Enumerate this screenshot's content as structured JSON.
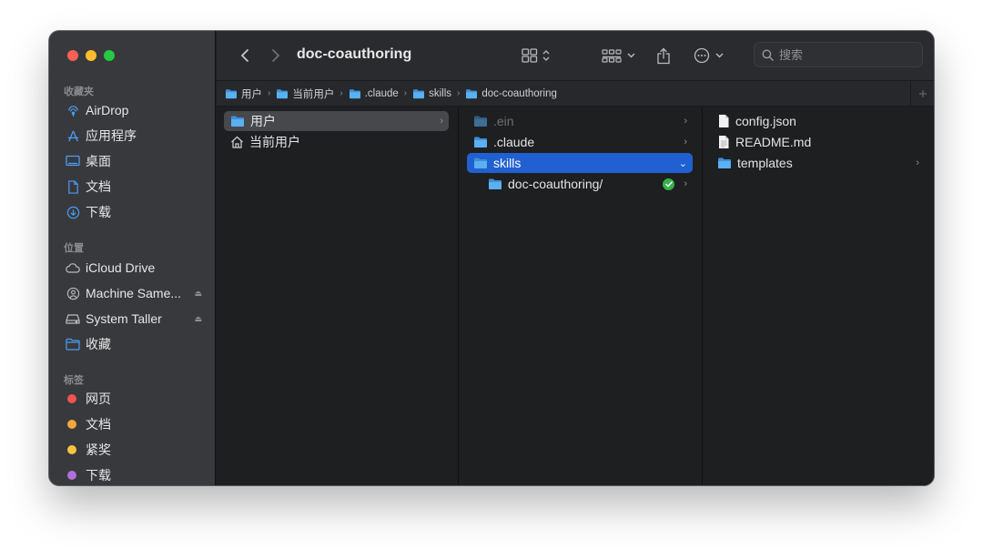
{
  "window": {
    "title": "doc-coauthoring"
  },
  "sidebar": {
    "favorites_label": "收藏夹",
    "favorites": [
      {
        "label": "AirDrop",
        "icon": "airdrop-icon"
      },
      {
        "label": "应用程序",
        "icon": "applications-icon"
      },
      {
        "label": "桌面",
        "icon": "desktop-icon"
      },
      {
        "label": "文档",
        "icon": "document-icon"
      },
      {
        "label": "下载",
        "icon": "download-icon"
      }
    ],
    "locations_label": "位置",
    "locations": [
      {
        "label": "iCloud Drive",
        "icon": "cloud-icon"
      },
      {
        "label": "Machine Same...",
        "icon": "network-drive-icon"
      },
      {
        "label": "System Taller",
        "icon": "disk-icon"
      },
      {
        "label": "收藏",
        "icon": "folder-icon"
      }
    ],
    "tags_label": "标签",
    "tags": [
      {
        "label": "网页",
        "color": "#ef5350"
      },
      {
        "label": "文档",
        "color": "#f4a53c"
      },
      {
        "label": "紧奖",
        "color": "#f6c344"
      },
      {
        "label": "下载",
        "color": "#b36fd9"
      }
    ]
  },
  "toolbar": {
    "search_placeholder": "搜索"
  },
  "pathbar": {
    "crumbs": [
      "用户",
      "当前用户",
      ".claude",
      "skills",
      "doc-coauthoring"
    ]
  },
  "columns": {
    "col1": [
      {
        "label": "用户"
      },
      {
        "label": "当前用户"
      }
    ],
    "col2": [
      {
        "label": ".ein"
      },
      {
        "label": ".claude"
      },
      {
        "label": "skills"
      },
      {
        "label": "doc-coauthoring/"
      }
    ],
    "col3": [
      {
        "label": "config.json"
      },
      {
        "label": "README.md"
      },
      {
        "label": "templates"
      }
    ]
  },
  "colors": {
    "selection_blue": "#2160d0",
    "folder_blue": "#4aa3ea",
    "sync_badge_green": "#35b24a"
  }
}
